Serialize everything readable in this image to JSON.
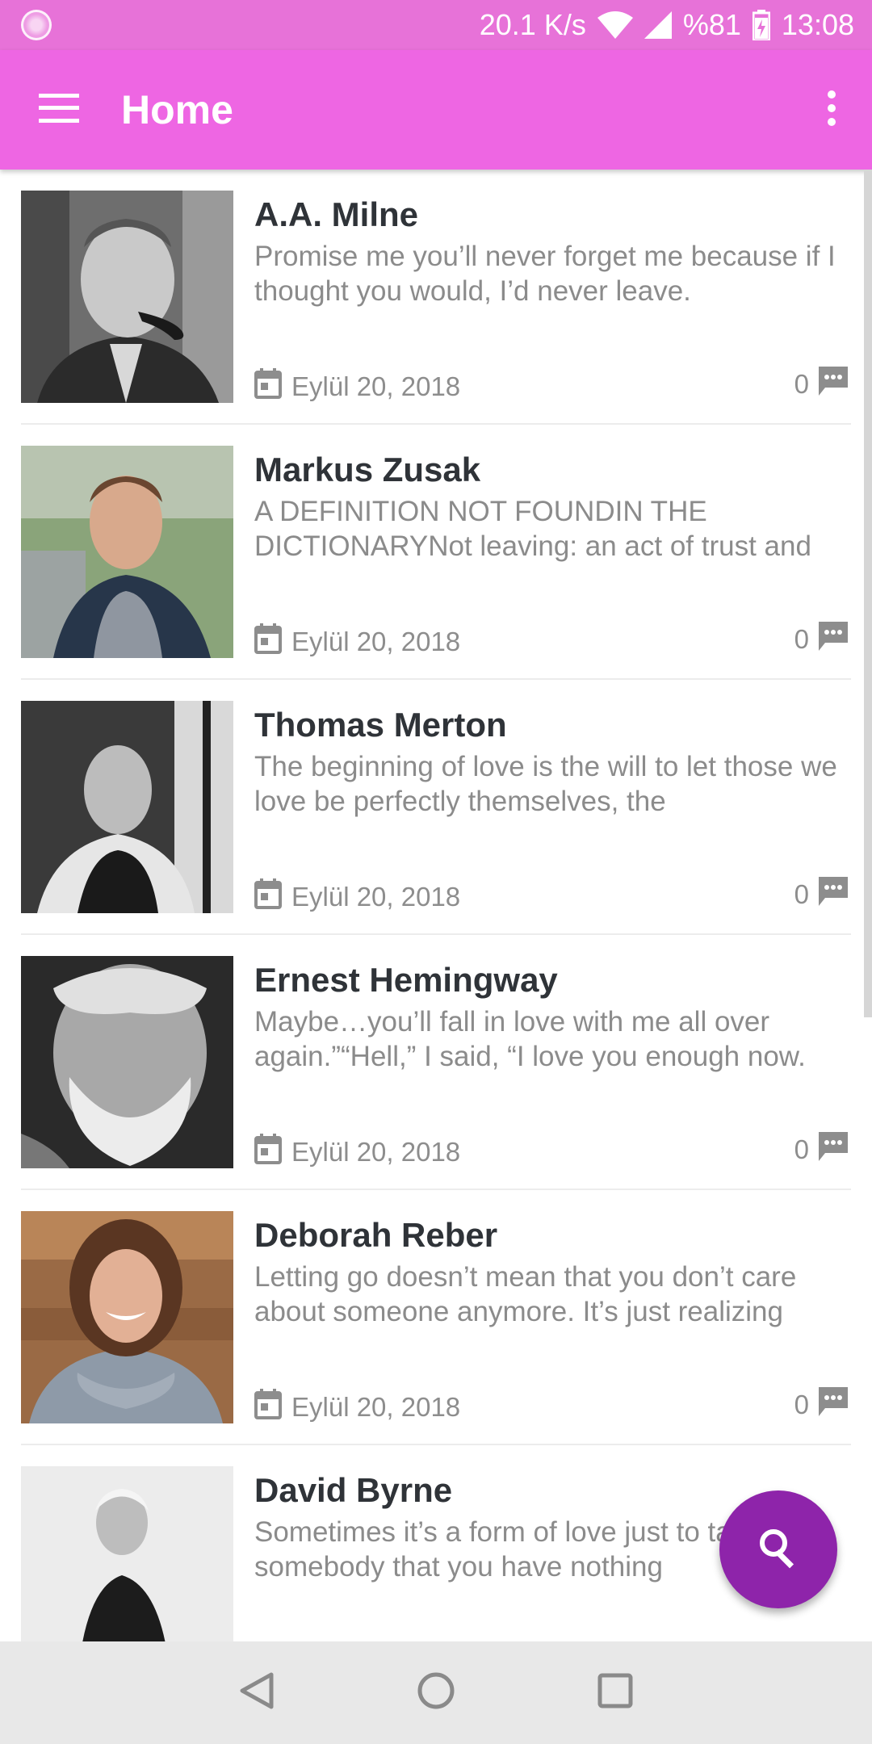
{
  "status_bar": {
    "speed": "20.1 K/s",
    "battery": "%81",
    "time": "13:08"
  },
  "app_bar": {
    "title": "Home",
    "menu_icon": "hamburger-menu-icon",
    "more_icon": "more-vert-icon"
  },
  "items": [
    {
      "author": "A.A. Milne",
      "text": "Promise me you’ll never forget me because if I thought you would, I’d never leave.",
      "date": "Eylül 20, 2018",
      "comments": "0"
    },
    {
      "author": "Markus Zusak",
      "text": "A DEFINITION NOT FOUNDIN THE DICTIONARYNot leaving: an act of trust and",
      "date": "Eylül 20, 2018",
      "comments": "0"
    },
    {
      "author": "Thomas Merton",
      "text": "The beginning of love is the will to let those we love be perfectly themselves, the",
      "date": "Eylül 20, 2018",
      "comments": "0"
    },
    {
      "author": "Ernest Hemingway",
      "text": "Maybe…you’ll fall in love with me all over again.”“Hell,” I said, “I love you enough now.",
      "date": "Eylül 20, 2018",
      "comments": "0"
    },
    {
      "author": "Deborah Reber",
      "text": "Letting go doesn’t mean that you don’t care about someone anymore. It’s just realizing",
      "date": "Eylül 20, 2018",
      "comments": "0"
    },
    {
      "author": "David Byrne",
      "text": "Sometimes it’s a form of love just to talk to somebody that you have nothing",
      "date": "",
      "comments": ""
    }
  ],
  "fab": {
    "icon": "search-icon"
  },
  "colors": {
    "status_bar": "#e772d8",
    "app_bar": "#ee66e3",
    "fab": "#8e24aa"
  }
}
